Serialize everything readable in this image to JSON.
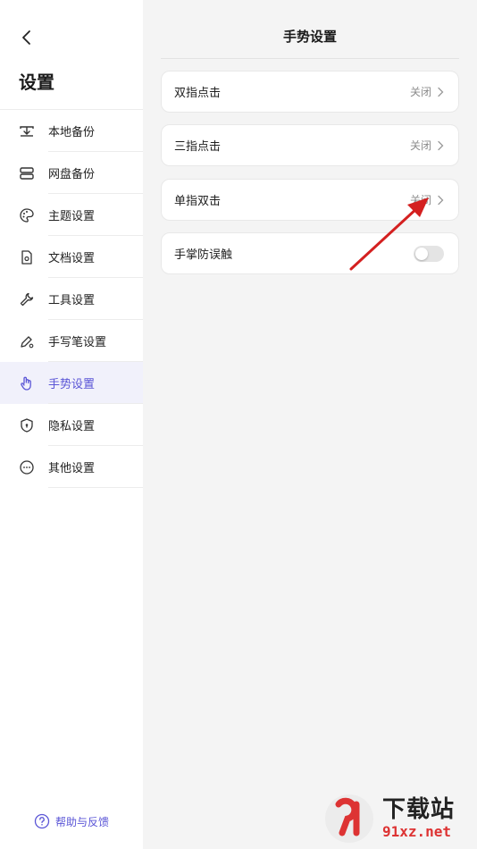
{
  "sidebar": {
    "title": "设置",
    "items": [
      {
        "label": "本地备份",
        "icon": "download-tray-icon"
      },
      {
        "label": "网盘备份",
        "icon": "server-icon"
      },
      {
        "label": "主题设置",
        "icon": "palette-icon"
      },
      {
        "label": "文档设置",
        "icon": "document-gear-icon"
      },
      {
        "label": "工具设置",
        "icon": "wrench-icon"
      },
      {
        "label": "手写笔设置",
        "icon": "pen-gear-icon"
      },
      {
        "label": "手势设置",
        "icon": "hand-gesture-icon",
        "active": true
      },
      {
        "label": "隐私设置",
        "icon": "shield-lock-icon"
      },
      {
        "label": "其他设置",
        "icon": "more-circle-icon"
      }
    ],
    "help_label": "帮助与反馈"
  },
  "main": {
    "title": "手势设置",
    "rows": [
      {
        "label": "双指点击",
        "value": "关闭"
      },
      {
        "label": "三指点击",
        "value": "关闭"
      },
      {
        "label": "单指双击",
        "value": "关闭"
      },
      {
        "label": "手掌防误触",
        "toggle": false
      }
    ]
  },
  "watermark": {
    "cn": "下载站",
    "en": "91xz.net"
  },
  "colors": {
    "accent": "#5a55d6",
    "active_bg": "#f1f1fb",
    "page_bg": "#f4f4f4",
    "annotation_arrow": "#d42020"
  }
}
